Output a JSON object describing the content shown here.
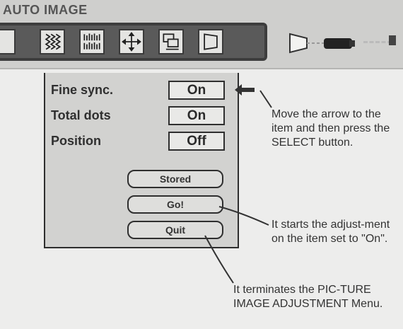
{
  "menu": {
    "title": "AUTO IMAGE"
  },
  "icons": [
    {
      "name": "fine-sync-icon"
    },
    {
      "name": "total-dots-icon"
    },
    {
      "name": "position-icon"
    },
    {
      "name": "copy-settings-icon"
    },
    {
      "name": "screen-shape-icon"
    }
  ],
  "dialog": {
    "rows": [
      {
        "label": "Fine sync.",
        "value": "On"
      },
      {
        "label": "Total dots",
        "value": "On"
      },
      {
        "label": "Position",
        "value": "Off"
      }
    ],
    "buttons": {
      "stored": "Stored",
      "go": "Go!",
      "quit": "Quit"
    }
  },
  "callouts": {
    "select": "Move the arrow to the item and then press the SELECT button.",
    "go": "It starts the adjust-ment on the item set to \"On\".",
    "quit": "It terminates the PIC-TURE IMAGE ADJUSTMENT Menu."
  }
}
